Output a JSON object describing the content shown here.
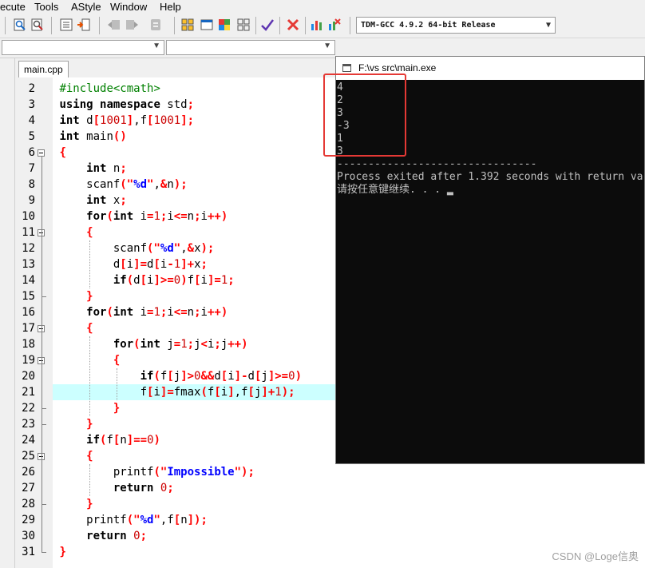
{
  "menu": {
    "items": [
      "ecute",
      "Tools",
      "AStyle",
      "Window",
      "Help"
    ]
  },
  "toolbar": {
    "compiler": "TDM-GCC 4.9.2 64-bit Release"
  },
  "tabs": [
    {
      "label": "main.cpp"
    }
  ],
  "editor": {
    "current_line": 21,
    "lines": [
      {
        "n": "2",
        "html": "<span class='pp'>#include&lt;cmath&gt;</span>"
      },
      {
        "n": "3",
        "html": "<span class='kw'>using namespace</span> std<span class='sym'>;</span>"
      },
      {
        "n": "4",
        "html": "<span class='kw'>int</span> d<span class='sym'>[</span><span class='num'>1001</span><span class='sym'>]</span>,f<span class='sym'>[</span><span class='num'>1001</span><span class='sym'>];</span>"
      },
      {
        "n": "5",
        "html": "<span class='kw'>int</span> main<span class='sym'>()</span>"
      },
      {
        "n": "6",
        "html": "<span class='sym'>{</span>"
      },
      {
        "n": "7",
        "html": "    <span class='kw'>int</span> n<span class='sym'>;</span>"
      },
      {
        "n": "8",
        "html": "    scanf<span class='sym'>(</span><span class='strq'>\"</span><span class='str'>%d</span><span class='strq'>\"</span>,<span class='sym'>&amp;</span>n<span class='sym'>);</span>"
      },
      {
        "n": "9",
        "html": "    <span class='kw'>int</span> x<span class='sym'>;</span>"
      },
      {
        "n": "10",
        "html": "    <span class='kw'>for</span><span class='sym'>(</span><span class='kw'>int</span> i<span class='sym'>=</span><span class='num'>1</span><span class='sym'>;</span>i<span class='sym'>&lt;=</span>n<span class='sym'>;</span>i<span class='sym'>++)</span>"
      },
      {
        "n": "11",
        "html": "    <span class='sym'>{</span>"
      },
      {
        "n": "12",
        "html": "        scanf<span class='sym'>(</span><span class='strq'>\"</span><span class='str'>%d</span><span class='strq'>\"</span>,<span class='sym'>&amp;</span>x<span class='sym'>);</span>"
      },
      {
        "n": "13",
        "html": "        d<span class='sym'>[</span>i<span class='sym'>]=</span>d<span class='sym'>[</span>i<span class='sym'>-</span><span class='num'>1</span><span class='sym'>]+</span>x<span class='sym'>;</span>"
      },
      {
        "n": "14",
        "html": "        <span class='kw'>if</span><span class='sym'>(</span>d<span class='sym'>[</span>i<span class='sym'>]&gt;=</span><span class='num'>0</span><span class='sym'>)</span>f<span class='sym'>[</span>i<span class='sym'>]=</span><span class='num'>1</span><span class='sym'>;</span>"
      },
      {
        "n": "15",
        "html": "    <span class='sym'>}</span>"
      },
      {
        "n": "16",
        "html": "    <span class='kw'>for</span><span class='sym'>(</span><span class='kw'>int</span> i<span class='sym'>=</span><span class='num'>1</span><span class='sym'>;</span>i<span class='sym'>&lt;=</span>n<span class='sym'>;</span>i<span class='sym'>++)</span>"
      },
      {
        "n": "17",
        "html": "    <span class='sym'>{</span>"
      },
      {
        "n": "18",
        "html": "        <span class='kw'>for</span><span class='sym'>(</span><span class='kw'>int</span> j<span class='sym'>=</span><span class='num'>1</span><span class='sym'>;</span>j<span class='sym'>&lt;</span>i<span class='sym'>;</span>j<span class='sym'>++)</span>"
      },
      {
        "n": "19",
        "html": "        <span class='sym'>{</span>"
      },
      {
        "n": "20",
        "html": "            <span class='kw'>if</span><span class='sym'>(</span>f<span class='sym'>[</span>j<span class='sym'>]&gt;</span><span class='num'>0</span><span class='sym'>&amp;&amp;</span>d<span class='sym'>[</span>i<span class='sym'>]-</span>d<span class='sym'>[</span>j<span class='sym'>]&gt;=</span><span class='num'>0</span><span class='sym'>)</span>"
      },
      {
        "n": "21",
        "html": "            f<span class='sym'>[</span>i<span class='sym'>]=</span>fmax<span class='sym'>(</span>f<span class='sym'>[</span>i<span class='sym'>]</span>,f<span class='sym'>[</span>j<span class='sym'>]+</span><span class='num'>1</span><span class='sym'>);</span>"
      },
      {
        "n": "22",
        "html": "        <span class='sym'>}</span>"
      },
      {
        "n": "23",
        "html": "    <span class='sym'>}</span>"
      },
      {
        "n": "24",
        "html": "    <span class='kw'>if</span><span class='sym'>(</span>f<span class='sym'>[</span>n<span class='sym'>]==</span><span class='num'>0</span><span class='sym'>)</span>"
      },
      {
        "n": "25",
        "html": "    <span class='sym'>{</span>"
      },
      {
        "n": "26",
        "html": "        printf<span class='sym'>(</span><span class='strq'>\"</span><span class='str'>Impossible</span><span class='strq'>\"</span><span class='sym'>);</span>"
      },
      {
        "n": "27",
        "html": "        <span class='kw'>return</span> <span class='num'>0</span><span class='sym'>;</span>"
      },
      {
        "n": "28",
        "html": "    <span class='sym'>}</span>"
      },
      {
        "n": "29",
        "html": "    printf<span class='sym'>(</span><span class='strq'>\"</span><span class='str'>%d</span><span class='strq'>\"</span>,f<span class='sym'>[</span>n<span class='sym'>]);</span>"
      },
      {
        "n": "30",
        "html": "    <span class='kw'>return</span> <span class='num'>0</span><span class='sym'>;</span>"
      },
      {
        "n": "31",
        "html": "<span class='sym'>}</span>"
      }
    ]
  },
  "console": {
    "title": "F:\\vs src\\main.exe",
    "lines": [
      "4",
      "2",
      "3",
      "-3",
      "1",
      "3",
      "--------------------------------",
      "Process exited after 1.392 seconds with return va",
      "请按任意键继续. . . ▂"
    ]
  },
  "watermark": "CSDN @Loge信奥",
  "colors": {
    "highlight": "#ccffff",
    "console_bg": "#0c0c0c",
    "annotation": "#e53935"
  }
}
